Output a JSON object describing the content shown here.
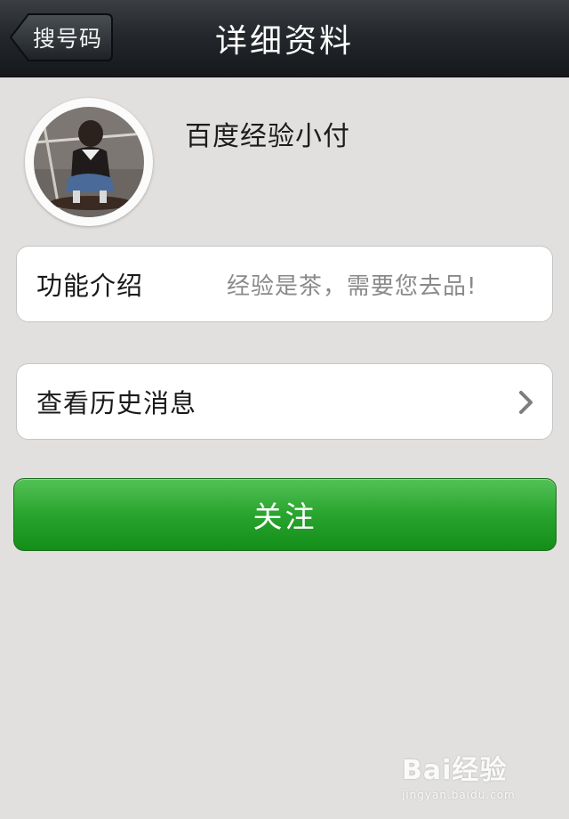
{
  "nav": {
    "back_label": "搜号码",
    "title": "详细资料"
  },
  "profile": {
    "name": "百度经验小付",
    "avatar_icon": "avatar-photo"
  },
  "intro": {
    "label": "功能介绍",
    "value": "经验是茶，需要您去品!"
  },
  "history": {
    "label": "查看历史消息",
    "chevron_icon": "chevron-right-icon"
  },
  "follow_button": {
    "label": "关注",
    "color": "#2aa52f"
  },
  "watermark": {
    "logo": "Bai经验",
    "url": "jingyan.baidu.com"
  },
  "colors": {
    "background": "#e1e0de",
    "nav_bar": "#24282c",
    "accent_green": "#2aa52f"
  }
}
